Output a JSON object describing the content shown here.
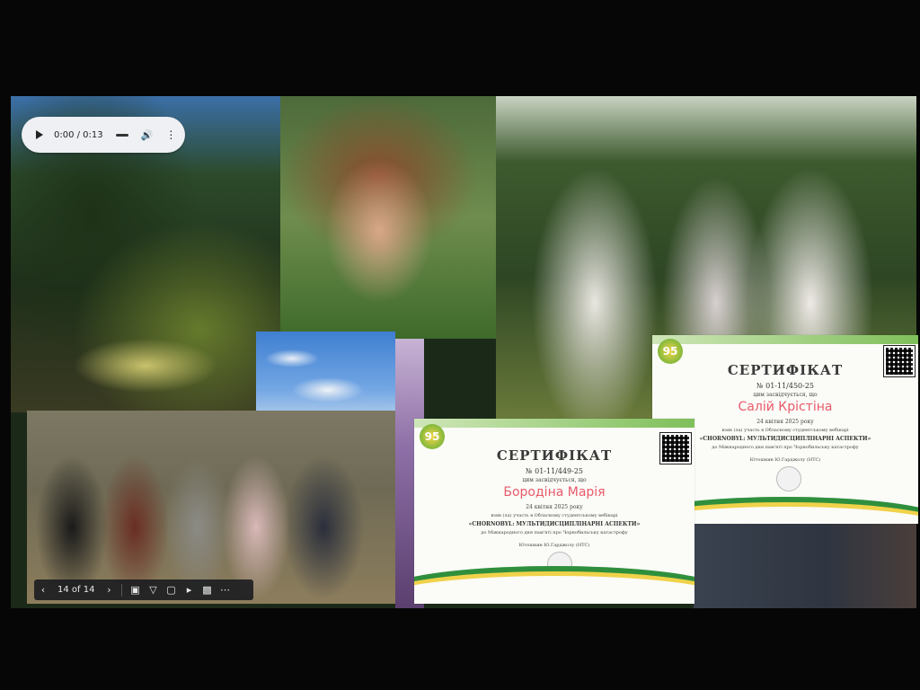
{
  "audio_player": {
    "time": "0:00 / 0:13",
    "icons": [
      "play-icon",
      "volume-icon",
      "more-vert-icon"
    ]
  },
  "toolbar": {
    "page_counter": "14 of 14",
    "icons": [
      "prev-icon",
      "next-icon",
      "slides-icon",
      "filter-icon",
      "crop-off-icon",
      "video-icon",
      "present-icon",
      "more-icon"
    ]
  },
  "certificate_left": {
    "badge": "95",
    "title": "СЕРТИФІКАТ",
    "number": "№ 01-11/449-25",
    "subtitle": "цим засвідчується, що",
    "name": "Бородіна Марія",
    "date": "24 квітня 2025 року",
    "line1": "взяв (ла) участь в Обласному студентському вебінарі",
    "line2": "«CHORNOBYL: МУЛЬТИДИСЦИПЛІНАРНІ АСПЕКТИ»",
    "line3": "до Міжнародного дня пам'яті про Чорнобильську катастрофу",
    "line4": "Ютошкин Ю.Гарджолу (НТС)"
  },
  "certificate_right": {
    "badge": "95",
    "title": "СЕРТИФІКАТ",
    "number": "№ 01-11/450-25",
    "subtitle": "цим засвідчується, що",
    "name": "Салій Крістіна",
    "date": "24 квітня 2025 року",
    "line1": "взяв (ла) участь в Обласному студентському вебінарі",
    "line2": "«CHORNOBYL: МУЛЬТИДИСЦИПЛІНАРНІ АСПЕКТИ»",
    "line3": "до Міжнародного дня пам'яті про Чорнобильську катастрофу",
    "line4": "Ютошкин Ю.Гарджолу (НТС)"
  },
  "colors": {
    "cert_green": "#2f8f3d",
    "cert_yellow": "#f0d24a",
    "cert_name_pink": "#e85a6a"
  }
}
